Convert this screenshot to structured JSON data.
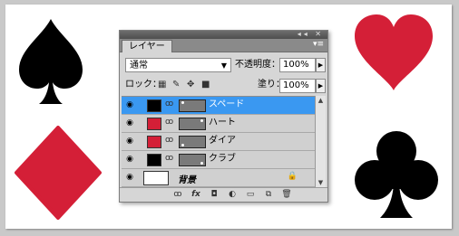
{
  "colors": {
    "red": "#d41f37",
    "black": "#000000",
    "selection": "#3a98f1"
  },
  "canvas_shapes": [
    "spade",
    "heart",
    "diamond",
    "club"
  ],
  "panel": {
    "tab_label": "レイヤー",
    "blend_mode": "通常",
    "opacity_label": "不透明度：",
    "opacity_value": "100%",
    "lock_label": "ロック：",
    "fill_label": "塗り：",
    "fill_value": "100%",
    "layers": [
      {
        "name": "スペード",
        "color": "#000000",
        "selected": true
      },
      {
        "name": "ハート",
        "color": "#d41f37",
        "selected": false
      },
      {
        "name": "ダイア",
        "color": "#d41f37",
        "selected": false
      },
      {
        "name": "クラブ",
        "color": "#000000",
        "selected": false
      }
    ],
    "background_layer": "背景",
    "bottom_icons": [
      "link-icon",
      "fx-icon",
      "mask-icon",
      "adjustment-icon",
      "group-icon",
      "new-layer-icon",
      "trash-icon"
    ]
  }
}
